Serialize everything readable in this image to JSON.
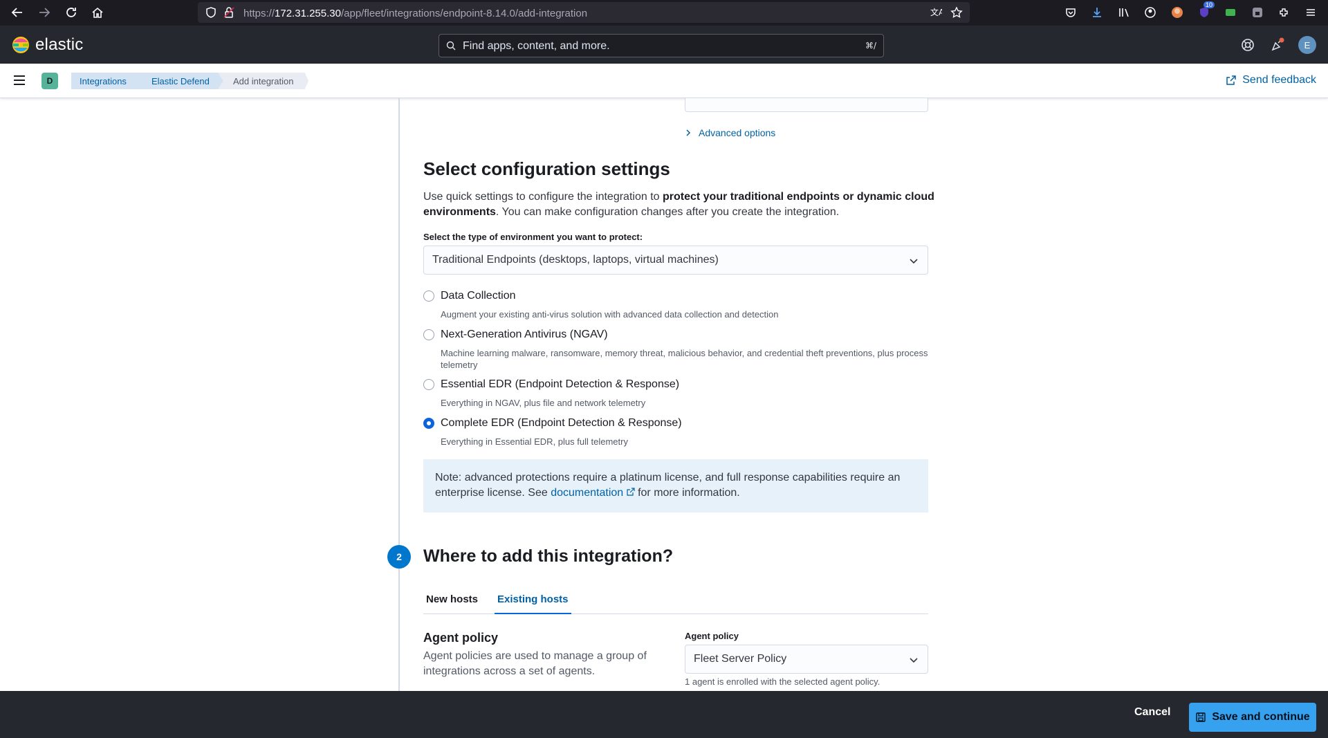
{
  "browser": {
    "url_prefix": "https://",
    "url_host": "172.31.255.30",
    "url_path": "/app/fleet/integrations/endpoint-8.14.0/add-integration",
    "extension_badge": "10"
  },
  "header": {
    "logo_text": "elastic",
    "search_placeholder": "Find apps, content, and more.",
    "search_shortcut": "⌘/",
    "avatar_initial": "E"
  },
  "subheader": {
    "space_initial": "D",
    "breadcrumbs": [
      "Integrations",
      "Elastic Defend",
      "Add integration"
    ],
    "feedback_label": "Send feedback"
  },
  "config": {
    "advanced_options": "Advanced options",
    "title": "Select configuration settings",
    "intro_a": "Use quick settings to configure the integration to ",
    "intro_bold": "protect your traditional endpoints or dynamic cloud environments",
    "intro_b": ". You can make configuration changes after you create the integration.",
    "env_label": "Select the type of environment you want to protect:",
    "env_value": "Traditional Endpoints (desktops, laptops, virtual machines)",
    "options": [
      {
        "label": "Data Collection",
        "desc": "Augment your existing anti-virus solution with advanced data collection and detection",
        "selected": false
      },
      {
        "label": "Next-Generation Antivirus (NGAV)",
        "desc": "Machine learning malware, ransomware, memory threat, malicious behavior, and credential theft preventions, plus process telemetry",
        "selected": false
      },
      {
        "label": "Essential EDR (Endpoint Detection & Response)",
        "desc": "Everything in NGAV, plus file and network telemetry",
        "selected": false
      },
      {
        "label": "Complete EDR (Endpoint Detection & Response)",
        "desc": "Everything in Essential EDR, plus full telemetry",
        "selected": true
      }
    ],
    "note_a": "Note: advanced protections require a platinum license, and full response capabilities require an enterprise license. See ",
    "note_link": "documentation",
    "note_b": " for more information."
  },
  "step2": {
    "number": "2",
    "title": "Where to add this integration?",
    "tabs": [
      "New hosts",
      "Existing hosts"
    ],
    "active_tab": "Existing hosts",
    "section_title": "Agent policy",
    "section_desc": "Agent policies are used to manage a group of integrations across a set of agents.",
    "policy_label": "Agent policy",
    "policy_value": "Fleet Server Policy",
    "policy_help": "1 agent is enrolled with the selected agent policy."
  },
  "footer": {
    "cancel_label": "Cancel",
    "save_label": "Save and continue"
  },
  "colors": {
    "accent": "#0b64dd",
    "link": "#0061a6",
    "header_bg": "#25282f",
    "callout_bg": "#e6f1fa",
    "save_bg": "#36a2ef"
  }
}
